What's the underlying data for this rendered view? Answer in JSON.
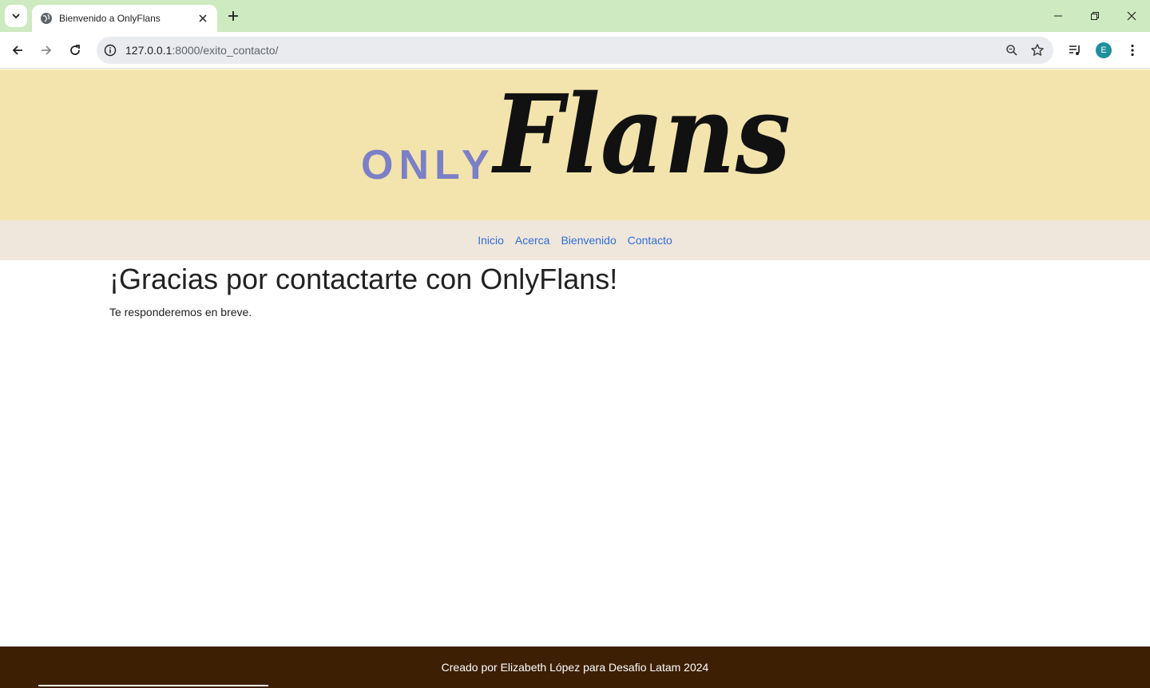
{
  "browser": {
    "tab_title": "Bienvenido a OnlyFlans",
    "url_host": "127.0.0.1",
    "url_path": ":8000/exito_contacto/",
    "profile_initial": "E"
  },
  "header": {
    "logo_only": "ONLY",
    "logo_flans": "Flans"
  },
  "nav": {
    "items": [
      {
        "label": "Inicio"
      },
      {
        "label": "Acerca"
      },
      {
        "label": "Bienvenido"
      },
      {
        "label": "Contacto"
      }
    ]
  },
  "main": {
    "title": "¡Gracias por contactarte con OnlyFlans!",
    "message": "Te responderemos en breve."
  },
  "footer": {
    "text": "Creado por Elizabeth López para Desafio Latam 2024"
  },
  "colors": {
    "tabbar": "#cdeac0",
    "hero": "#f3e4ad",
    "nav": "#efe6dc",
    "link": "#2f6fd8",
    "footer": "#3d1f04",
    "logo_only": "#7b7fc6"
  },
  "icons": [
    "tab-search-icon",
    "globe-icon",
    "close-icon",
    "plus-icon",
    "minimize-icon",
    "restore-icon",
    "back-arrow-icon",
    "forward-arrow-icon",
    "reload-icon",
    "site-info-icon",
    "zoom-icon",
    "bookmark-star-icon",
    "media-controls-icon",
    "menu-dots-icon"
  ]
}
